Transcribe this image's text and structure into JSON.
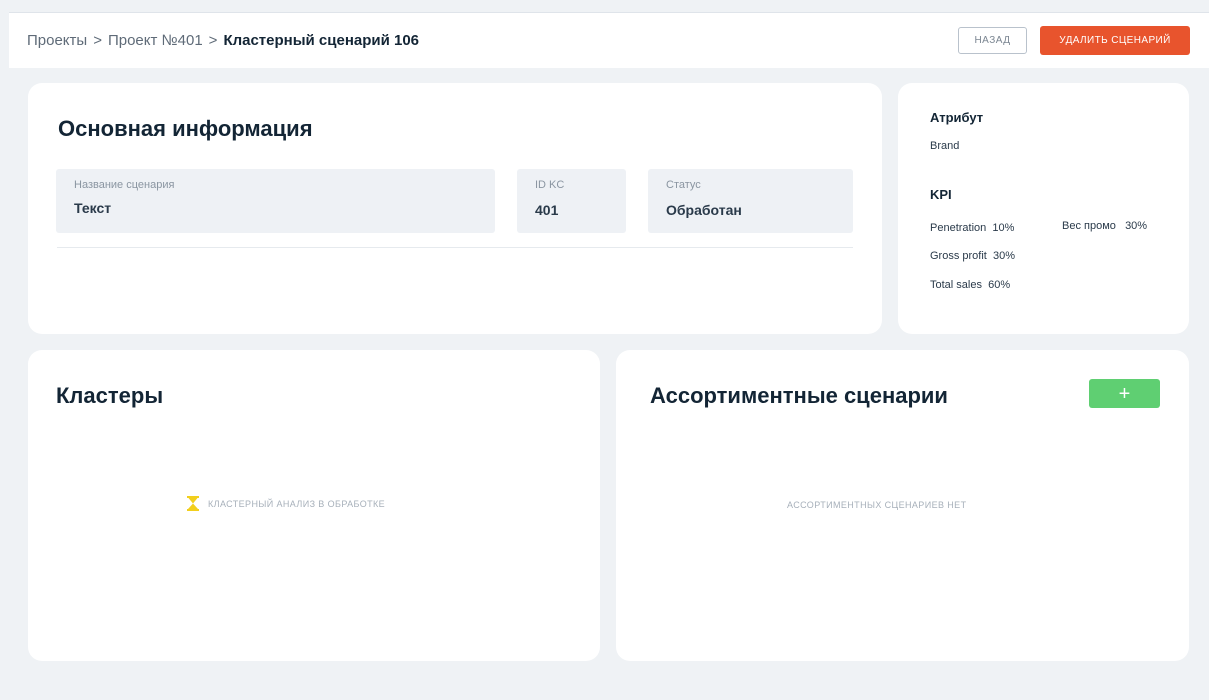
{
  "breadcrumb": {
    "projects": "Проекты",
    "project": "Проект №401",
    "current": "Кластерный сценарий 106",
    "separator": ">"
  },
  "actions": {
    "back_label": "НАЗАД",
    "delete_label": "УДАЛИТЬ СЦЕНАРИЙ"
  },
  "main_info": {
    "title": "Основная информация",
    "fields": [
      {
        "label": "Название сценария",
        "value": "Текст"
      },
      {
        "label": "ID KC",
        "value": "401"
      },
      {
        "label": "Статус",
        "value": "Обработан"
      }
    ]
  },
  "attribute": {
    "title": "Атрибут",
    "value": "Brand",
    "kpi_title": "KPI",
    "kpis": [
      {
        "name": "Penetration",
        "value": "10%"
      },
      {
        "name": "Вес промо",
        "value": "30%"
      },
      {
        "name": "Gross profit",
        "value": "30%"
      },
      {
        "name": "Total sales",
        "value": "60%"
      }
    ]
  },
  "clusters": {
    "title": "Кластеры",
    "status": "КЛАСТЕРНЫЙ АНАЛИЗ В ОБРАБОТКЕ",
    "status_icon": "hourglass-icon"
  },
  "assortment": {
    "title": "Ассортиментные сценарии",
    "add_label": "+",
    "empty": "АССОРТИМЕНТНЫХ СЦЕНАРИЕВ НЕТ"
  },
  "colors": {
    "accent_red": "#e8542d",
    "accent_green": "#5fcf72",
    "hourglass": "#f2cf1d",
    "background": "#eff2f5"
  }
}
